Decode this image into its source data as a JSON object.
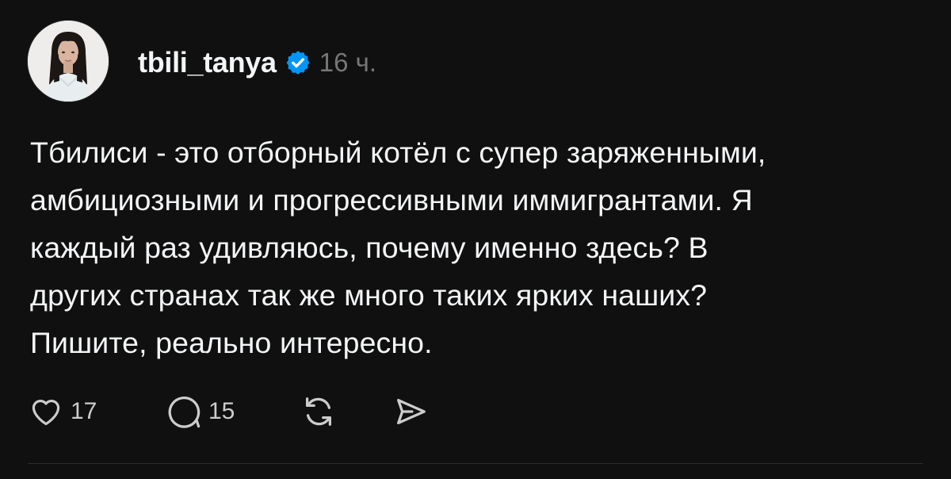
{
  "post": {
    "author": {
      "username": "tbili_tanya",
      "verified": true,
      "avatar_icon": "profile-photo"
    },
    "timestamp": "16 ч.",
    "text_lines": [
      "Тбилиси - это отборный котёл с супер заряженными,",
      "амбициозными и прогрессивными иммигрантами. Я",
      "каждый раз удивляюсь, почему именно здесь? В",
      "других странах так же много таких ярких наших?",
      "Пишите, реально интересно."
    ],
    "actions": {
      "like": {
        "icon": "heart-icon",
        "count": "17"
      },
      "reply": {
        "icon": "comment-icon",
        "count": "15"
      },
      "repost": {
        "icon": "repost-icon"
      },
      "share": {
        "icon": "send-icon"
      }
    }
  },
  "colors": {
    "background": "#101010",
    "text": "#f3f5f7",
    "muted": "#777777",
    "verified": "#0095f6"
  }
}
